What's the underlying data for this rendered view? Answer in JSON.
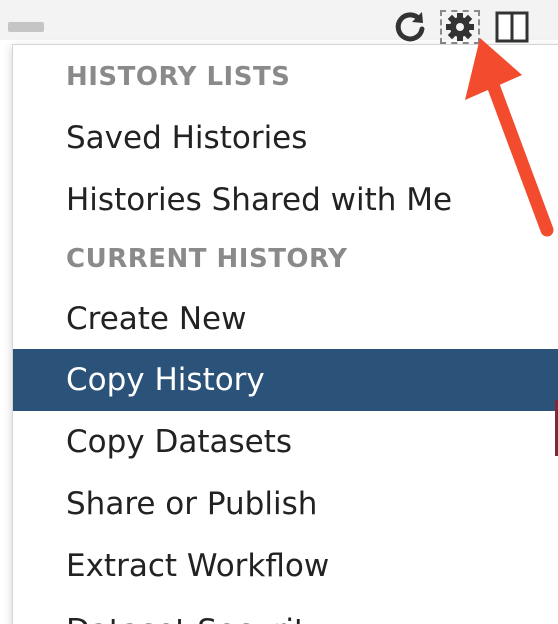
{
  "toolbar": {
    "icons": [
      "refresh-icon",
      "gear-icon",
      "columns-icon"
    ]
  },
  "menu": {
    "items": [
      {
        "type": "header",
        "label": "HISTORY LISTS"
      },
      {
        "type": "item",
        "label": "Saved Histories"
      },
      {
        "type": "item",
        "label": "Histories Shared with Me"
      },
      {
        "type": "header",
        "label": "CURRENT HISTORY"
      },
      {
        "type": "item",
        "label": "Create New"
      },
      {
        "type": "item",
        "label": "Copy History",
        "active": true
      },
      {
        "type": "item",
        "label": "Copy Datasets"
      },
      {
        "type": "item",
        "label": "Share or Publish"
      },
      {
        "type": "item",
        "label": "Extract Workflow"
      },
      {
        "type": "item",
        "label": "Dataset Security",
        "partially_visible": true
      }
    ]
  },
  "colors": {
    "active_background": "#2b5278",
    "header_text": "#8a8a8a",
    "arrow": "#f24b2d"
  }
}
